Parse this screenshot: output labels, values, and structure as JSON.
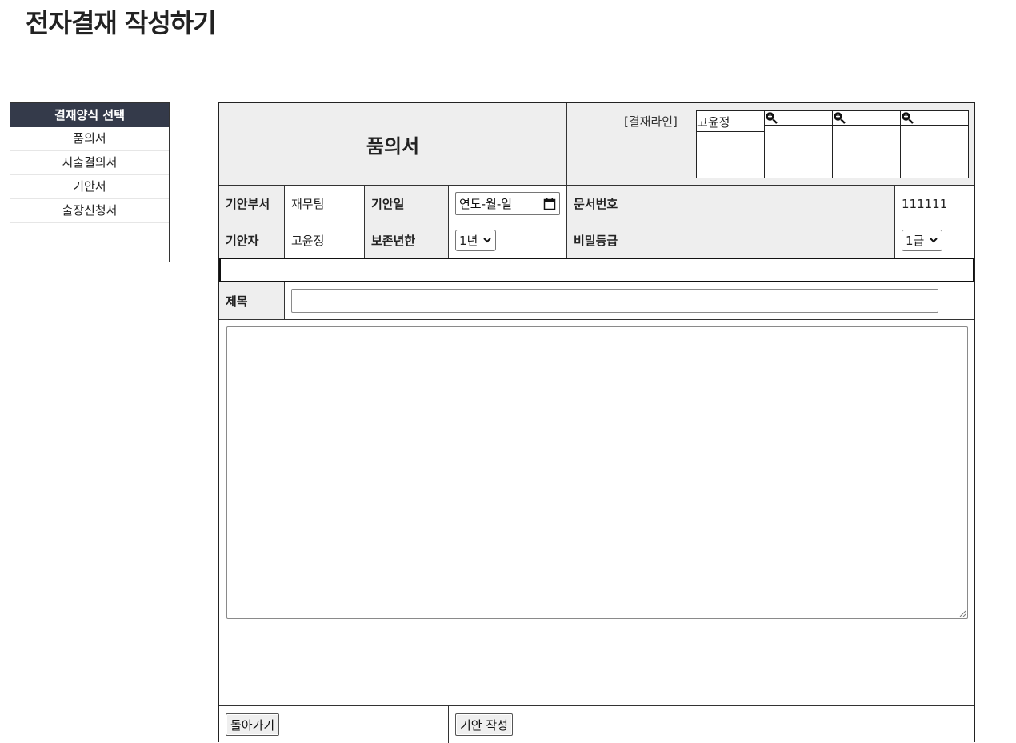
{
  "page": {
    "title": "전자결재 작성하기"
  },
  "sidebar": {
    "header": "결재양식 선택",
    "items": [
      {
        "label": "품의서"
      },
      {
        "label": "지출결의서"
      },
      {
        "label": "기안서"
      },
      {
        "label": "출장신청서"
      }
    ]
  },
  "form": {
    "doc_title": "품의서",
    "approval": {
      "label": "[결재라인]",
      "slots": [
        {
          "name": "고윤정",
          "icon": ""
        },
        {
          "name": "",
          "icon": "zoom-in-icon"
        },
        {
          "name": "",
          "icon": "zoom-in-icon"
        },
        {
          "name": "",
          "icon": "zoom-in-icon"
        }
      ]
    },
    "fields": {
      "dept_label": "기안부서",
      "dept_value": "재무팀",
      "date_label": "기안일",
      "date_placeholder": "연도-월-일",
      "docno_label": "문서번호",
      "docno_value": "111111",
      "drafter_label": "기안자",
      "drafter_value": "고윤정",
      "retention_label": "보존년한",
      "retention_value": "1년",
      "security_label": "비밀등급",
      "security_value": "1급",
      "subject_label": "제목",
      "subject_value": "",
      "content_value": ""
    },
    "buttons": {
      "back": "돌아가기",
      "submit": "기안 작성"
    }
  }
}
